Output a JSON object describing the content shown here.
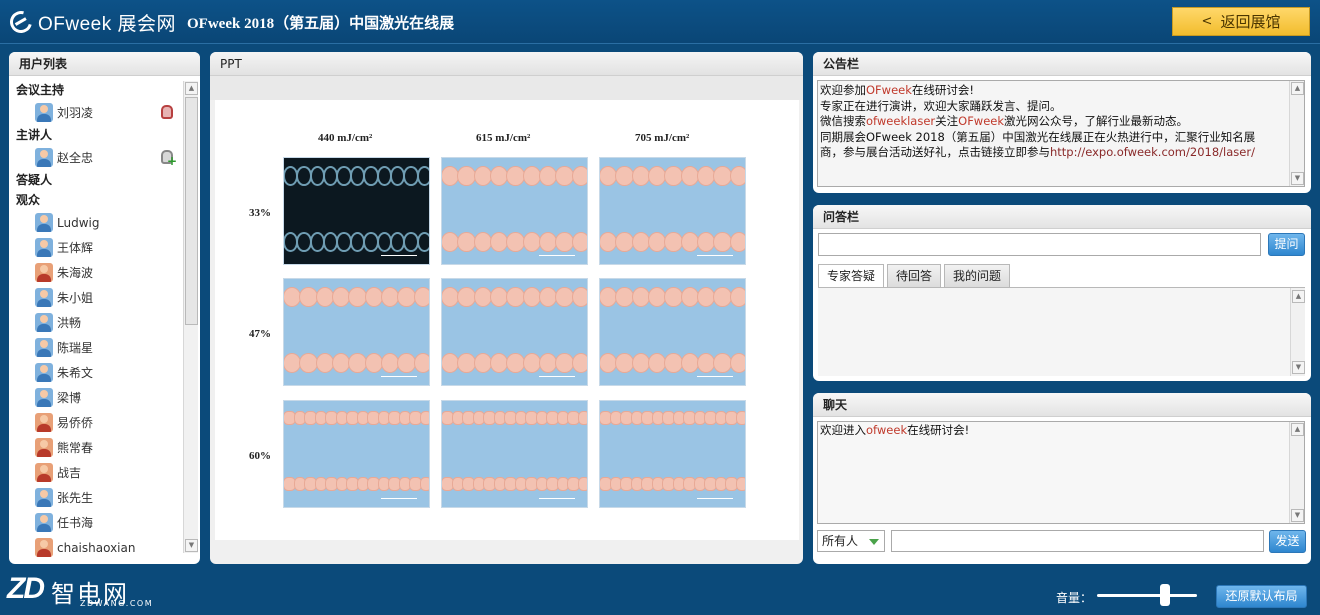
{
  "header": {
    "logo_text": "OFweek 展会网",
    "event_title": "OFweek 2018（第五届）中国激光在线展",
    "back_label": "返回展馆"
  },
  "user_list": {
    "title": "用户列表",
    "host_label": "会议主持",
    "host": "刘羽凌",
    "speaker_label": "主讲人",
    "speaker": "赵全忠",
    "qa_label": "答疑人",
    "audience_label": "观众",
    "audience": [
      {
        "name": "Ludwig",
        "gender": "male"
      },
      {
        "name": "王体辉",
        "gender": "male"
      },
      {
        "name": "朱海波",
        "gender": "female"
      },
      {
        "name": "朱小姐",
        "gender": "male"
      },
      {
        "name": "洪畅",
        "gender": "male"
      },
      {
        "name": "陈瑞星",
        "gender": "male"
      },
      {
        "name": "朱希文",
        "gender": "male"
      },
      {
        "name": "梁博",
        "gender": "male"
      },
      {
        "name": "易侨侨",
        "gender": "female"
      },
      {
        "name": "熊常春",
        "gender": "female"
      },
      {
        "name": "战吉",
        "gender": "female"
      },
      {
        "name": "张先生",
        "gender": "male"
      },
      {
        "name": "任书海",
        "gender": "male"
      },
      {
        "name": "chaishaoxian",
        "gender": "female"
      }
    ]
  },
  "ppt": {
    "title": "PPT",
    "columns": [
      "440 mJ/cm²",
      "615 mJ/cm²",
      "705 mJ/cm²"
    ],
    "rows": [
      "33%",
      "47%",
      "60%"
    ]
  },
  "notice": {
    "title": "公告栏",
    "line1_a": "欢迎参加",
    "line1_b": "OFweek",
    "line1_c": "在线研讨会!",
    "line2": "专家正在进行演讲，欢迎大家踊跃发言、提问。",
    "line3_a": "微信搜索",
    "line3_b": "ofweeklaser",
    "line3_c": "关注",
    "line3_d": "OFweek",
    "line3_e": "激光网公众号，了解行业最新动态。",
    "line4": "同期展会OFweek 2018（第五届）中国激光在线展正在火热进行中，汇聚行业知名展",
    "line5_a": "商，参与展台活动送好礼，点击链接立即参与",
    "line5_url": "http://expo.ofweek.com/2018/laser/"
  },
  "qa": {
    "title": "问答栏",
    "ask_label": "提问",
    "tabs": [
      "专家答疑",
      "待回答",
      "我的问题"
    ]
  },
  "chat": {
    "title": "聊天",
    "welcome_a": "欢迎进入",
    "welcome_b": "ofweek",
    "welcome_c": "在线研讨会!",
    "recipient": "所有人",
    "send_label": "发送"
  },
  "footer": {
    "brand_latin": "ZD",
    "brand_cn": "智电网",
    "brand_url": "ZDWANG.COM",
    "volume_label": "音量：",
    "volume_level": 0.68,
    "reset_label": "还原默认布局"
  },
  "colors": {
    "background": "#0b4a7a",
    "back_button": "#f2bd2d",
    "action_button": "#2e86cf"
  }
}
